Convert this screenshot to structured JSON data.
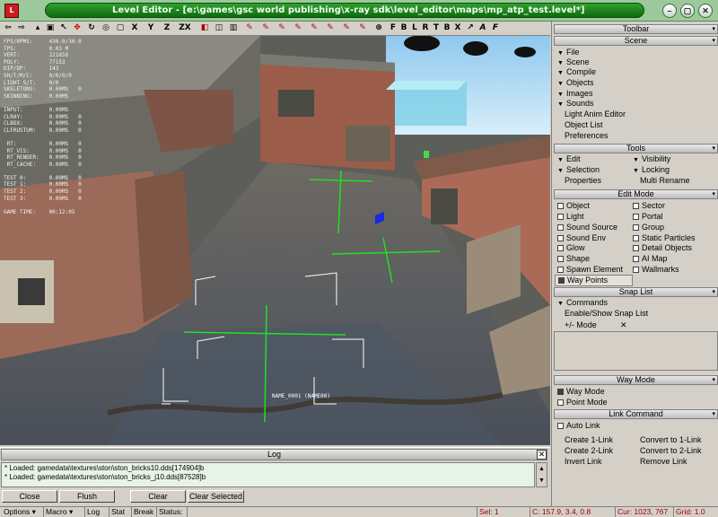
{
  "window": {
    "title": "Level Editor - [e:\\games\\gsc world publishing\\x-ray sdk\\level_editor\\maps\\mp_atp_test.level*]",
    "icon_label": "L"
  },
  "toolbar_letters": [
    "X",
    "Y",
    "Z",
    "ZX",
    "F",
    "B",
    "L",
    "R",
    "T",
    "B",
    "X"
  ],
  "viewport": {
    "stats": "FPS/RPMS:     430.0/30.0\nTPS:          0.03 M\nVERT:         221856\nPOLY:         77153\nDIP/DP:       143\nSH/T/M/C:     0/0/0/0\nLIGHT S/T:    0/0\nSKELETONS:    0.00MS   0\nSKINNING:     0.00MS\n\nINPUT:        0.00MS\nCLRAY:        0.00MS   0\nCLBOX:        0.00MS   0\nCLFRUSTUM:    0.00MS   0\n\n RT:          0.00MS   0\n RT_VIS:      0.00MS   0\n RT_RENDER:   0.00MS   0\n RT_CACHE:    0.00MS   0\n\nTEST 0:       0.00MS   0\nTEST 1:       0.00MS   0\nTEST 2:       0.00MS   0\nTEST 3:       0.00MS   0\n\nGAME TIME:    00:12:05",
    "object_label": "NAME_0001 (NAME00)"
  },
  "log": {
    "title": "Log",
    "lines": [
      "* Loaded: gamedata\\textures\\ston\\ston_bricks10.dds[174904]b",
      "* Loaded: gamedata\\textures\\ston\\ston_bricks_j10.dds[87528]b"
    ],
    "buttons": {
      "close": "Close",
      "flush": "Flush",
      "clear": "Clear",
      "clear_selected": "Clear Selected"
    }
  },
  "statusbar": {
    "options": "Options",
    "macro": "Macro",
    "log": "Log",
    "stat": "Stat",
    "break": "Break",
    "status": "Status:",
    "sel": "Sel: 1",
    "coords": "C: 157.9, 3.4, 0.8",
    "cur": "Cur: 1023, 767",
    "grid": "Grid: 1.0"
  },
  "panel": {
    "toolbar_title": "Toolbar",
    "scene": {
      "title": "Scene",
      "menu": [
        "File",
        "Scene",
        "Compile",
        "Objects",
        "Images",
        "Sounds"
      ],
      "links": [
        "Light Anim Editor",
        "Object List",
        "Preferences"
      ]
    },
    "tools": {
      "title": "Tools",
      "edit": "Edit",
      "visibility": "Visibility",
      "selection": "Selection",
      "locking": "Locking",
      "properties": "Properties",
      "multi_rename": "Multi Rename"
    },
    "edit_mode": {
      "title": "Edit Mode",
      "left": [
        "Object",
        "Light",
        "Sound Source",
        "Sound Env",
        "Glow",
        "Shape",
        "Spawn Element",
        "Way Points"
      ],
      "right": [
        "Sector",
        "Portal",
        "Group",
        "Static Particles",
        "Detail Objects",
        "AI Map",
        "Wallmarks"
      ]
    },
    "snap_list": {
      "title": "Snap List",
      "commands": "Commands",
      "enable_show": "Enable/Show Snap List",
      "mode_label": "+/- Mode",
      "remove": "✕"
    },
    "way_mode": {
      "title": "Way Mode",
      "items": [
        "Way Mode",
        "Point Mode"
      ]
    },
    "link_command": {
      "title": "Link Command",
      "auto_link": "Auto Link",
      "left": [
        "Create 1-Link",
        "Create 2-Link",
        "Invert Link"
      ],
      "right": [
        "Convert to 1-Link",
        "Convert to 2-Link",
        "Remove Link"
      ]
    }
  }
}
